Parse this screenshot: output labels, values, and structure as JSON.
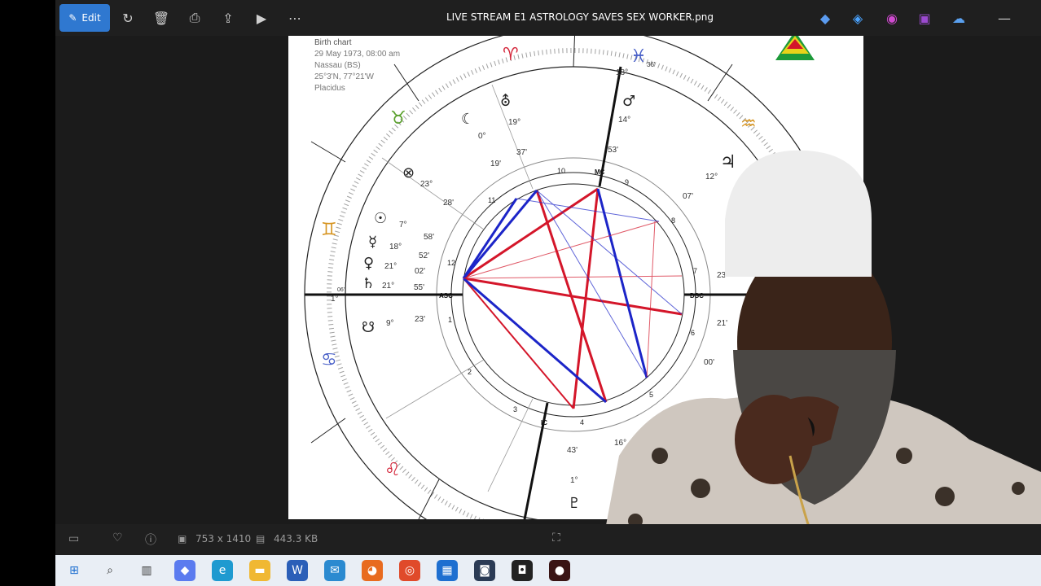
{
  "window": {
    "title": "LIVE STREAM E1 ASTROLOGY SAVES SEX WORKER.png"
  },
  "toolbar": {
    "edit_label": "Edit"
  },
  "status": {
    "dimensions": "753 x 1410",
    "filesize": "443.3 KB"
  },
  "chart": {
    "header": [
      "Birth chart",
      "29 May 1973, 08:00 am",
      "Nassau (BS)",
      "25°3'N,     77°21'W",
      "Placidus"
    ],
    "angles": {
      "asc": "ASC",
      "dsc": "DSC",
      "mc": "MC",
      "ic": "IC"
    },
    "houses": [
      "1",
      "2",
      "3",
      "4",
      "5",
      "6",
      "7",
      "8",
      "9",
      "10",
      "11",
      "12"
    ],
    "labels": {
      "mc_deg": "18°",
      "mc_min": "36'",
      "asc_deg": "1°",
      "asc_min": "06'",
      "mars_deg": "14°",
      "mars_min": "53'",
      "uranus_deg": "19°",
      "uranus_min": "37'",
      "moon_deg": "0°",
      "moon_min": "19'",
      "pof_deg": "23°",
      "pof_min": "28'",
      "sun_deg": "7°",
      "sun_min": "58'",
      "mercury_deg": "18°",
      "mercury_min": "52'",
      "venus_deg": "21°",
      "venus_min": "02'",
      "saturn_deg": "21°",
      "saturn_min": "55'",
      "node_deg": "9°",
      "node_min": "23'",
      "jupiter_deg": "12°",
      "jupiter_min": "07'",
      "dsc_deg": "23'",
      "r21": "21'",
      "r00": "00'",
      "neptune_deg": "43'",
      "pluto_deg": "1°",
      "b16": "16°"
    }
  }
}
